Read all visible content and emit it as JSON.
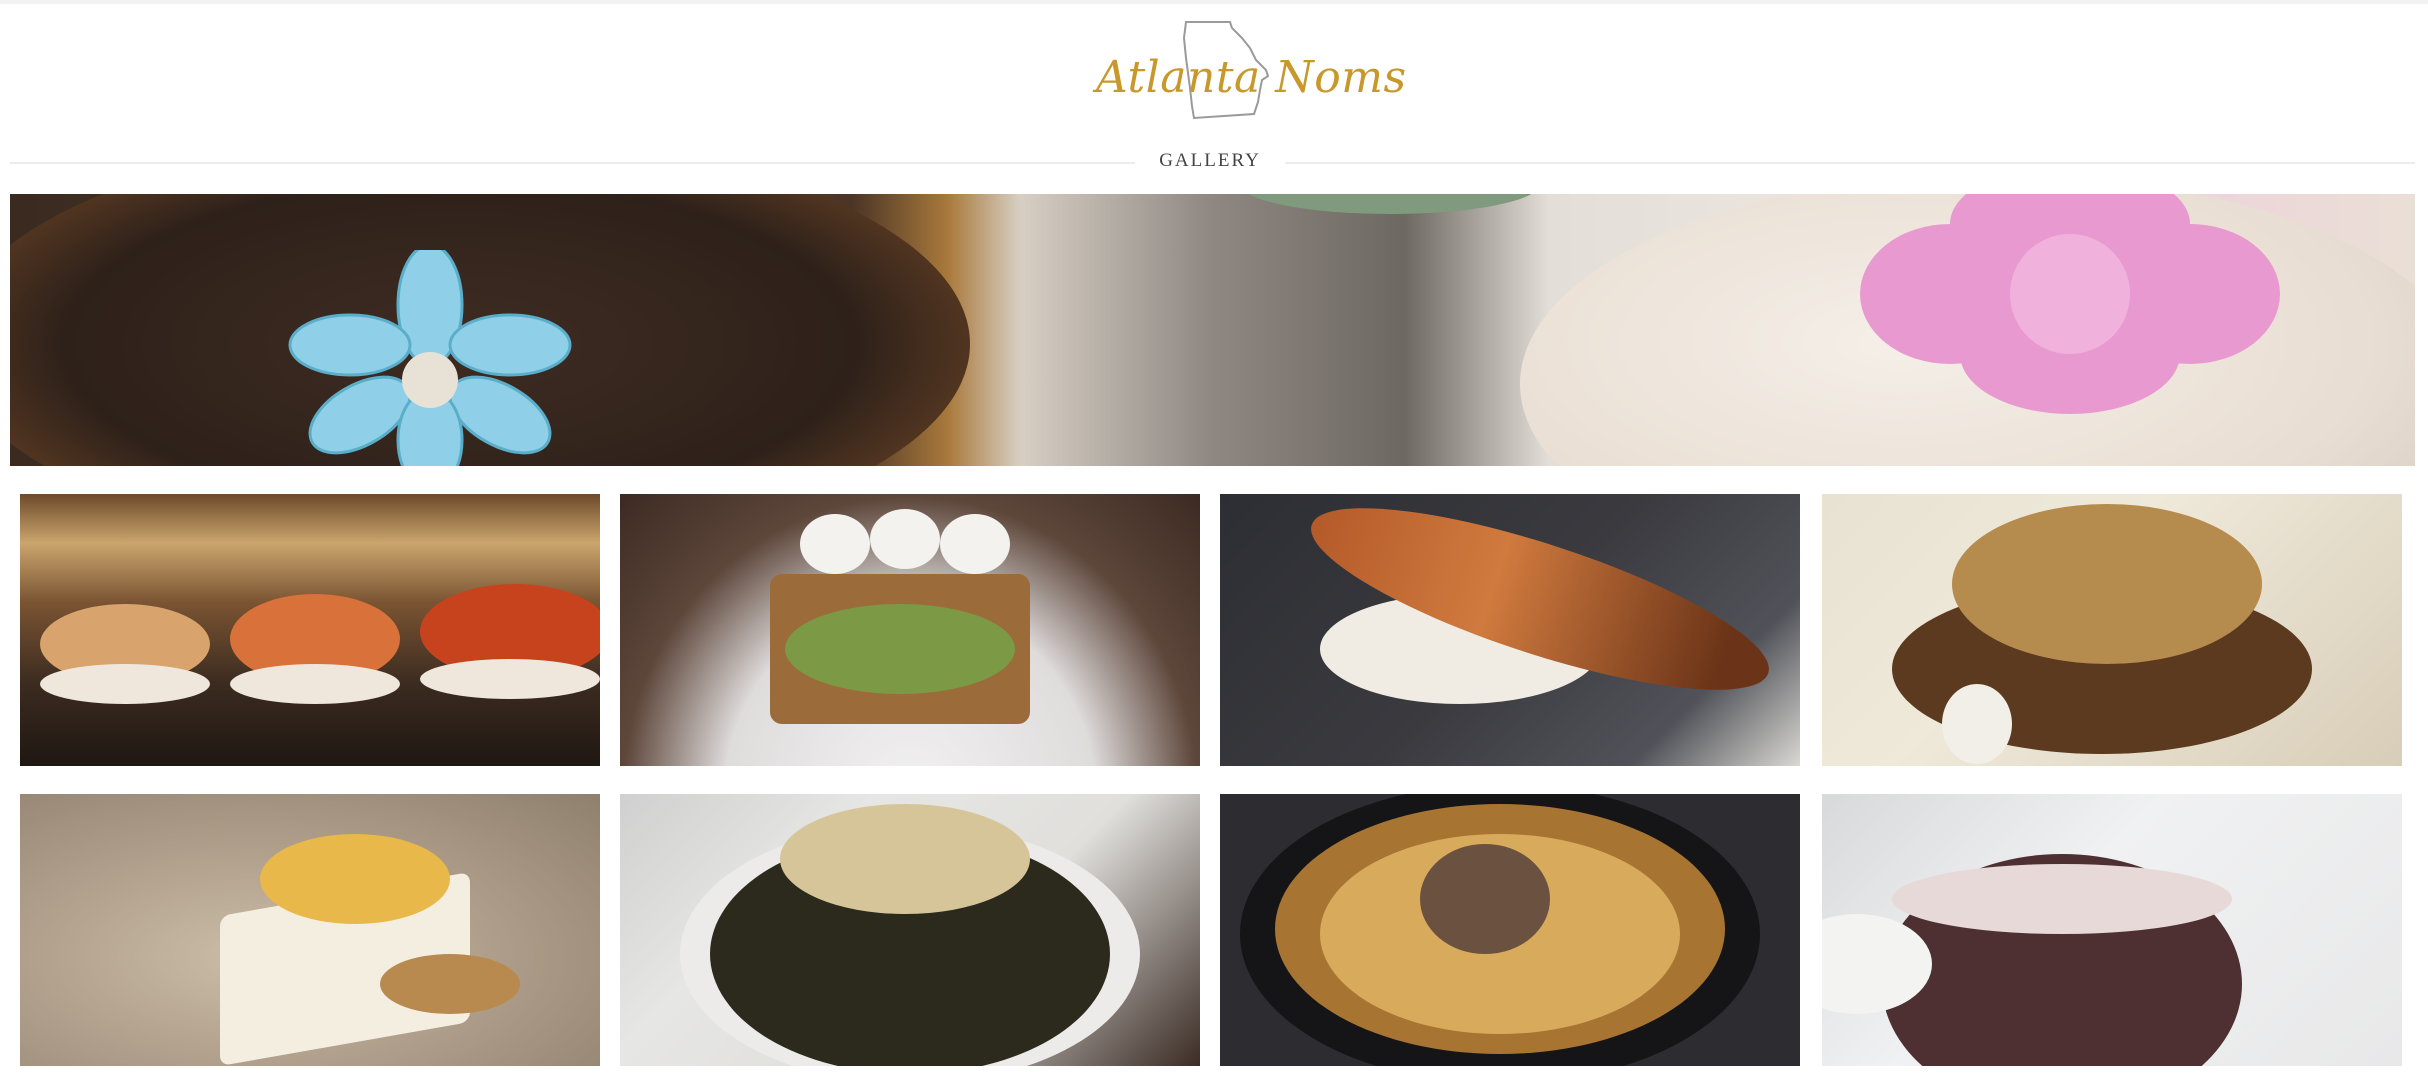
{
  "site": {
    "logo_text": "Atlanta Noms",
    "logo_icon": "georgia-state-outline-icon"
  },
  "gallery": {
    "label": "GALLERY"
  },
  "colors": {
    "logo_gold": "#c8982a",
    "divider": "#ececec",
    "label_text": "#444444"
  }
}
